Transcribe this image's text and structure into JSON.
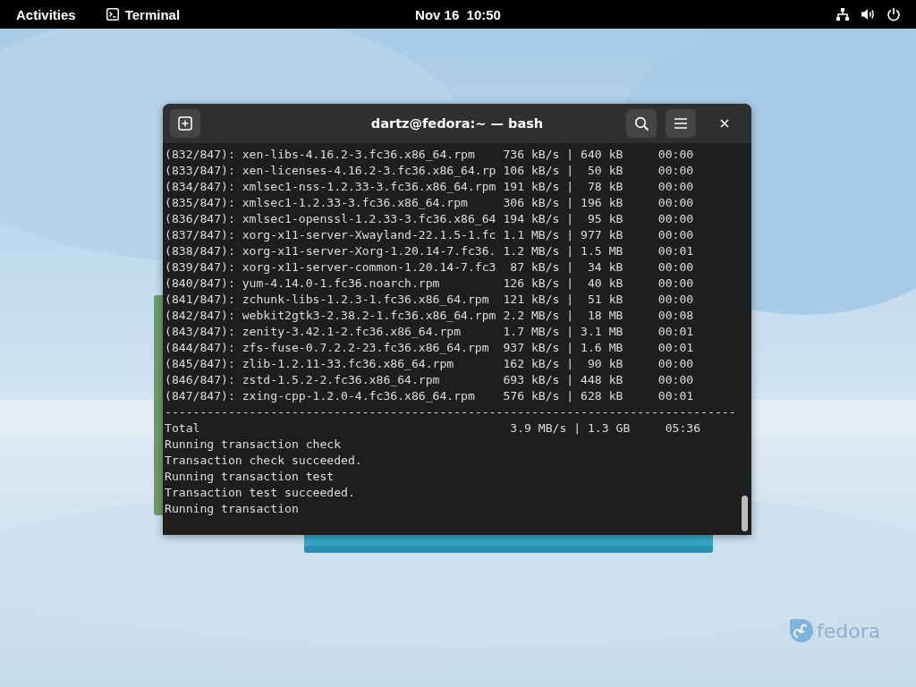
{
  "top_bar": {
    "activities": "Activities",
    "app_menu": "Terminal",
    "clock": "Nov 16  10:50"
  },
  "terminal": {
    "title": "dartz@fedora:~ — bash",
    "lines": [
      "(832/847): xen-libs-4.16.2-3.fc36.x86_64.rpm    736 kB/s | 640 kB     00:00",
      "(833/847): xen-licenses-4.16.2-3.fc36.x86_64.rp 106 kB/s |  50 kB     00:00",
      "(834/847): xmlsec1-nss-1.2.33-3.fc36.x86_64.rpm 191 kB/s |  78 kB     00:00",
      "(835/847): xmlsec1-1.2.33-3.fc36.x86_64.rpm     306 kB/s | 196 kB     00:00",
      "(836/847): xmlsec1-openssl-1.2.33-3.fc36.x86_64 194 kB/s |  95 kB     00:00",
      "(837/847): xorg-x11-server-Xwayland-22.1.5-1.fc 1.1 MB/s | 977 kB     00:00",
      "(838/847): xorg-x11-server-Xorg-1.20.14-7.fc36. 1.2 MB/s | 1.5 MB     00:01",
      "(839/847): xorg-x11-server-common-1.20.14-7.fc3  87 kB/s |  34 kB     00:00",
      "(840/847): yum-4.14.0-1.fc36.noarch.rpm         126 kB/s |  40 kB     00:00",
      "(841/847): zchunk-libs-1.2.3-1.fc36.x86_64.rpm  121 kB/s |  51 kB     00:00",
      "(842/847): webkit2gtk3-2.38.2-1.fc36.x86_64.rpm 2.2 MB/s |  18 MB     00:08",
      "(843/847): zenity-3.42.1-2.fc36.x86_64.rpm      1.7 MB/s | 3.1 MB     00:01",
      "(844/847): zfs-fuse-0.7.2.2-23.fc36.x86_64.rpm  937 kB/s | 1.6 MB     00:01",
      "(845/847): zlib-1.2.11-33.fc36.x86_64.rpm       162 kB/s |  90 kB     00:00",
      "(846/847): zstd-1.5.2-2.fc36.x86_64.rpm         693 kB/s | 448 kB     00:00",
      "(847/847): zxing-cpp-1.2.0-4.fc36.x86_64.rpm    576 kB/s | 628 kB     00:01",
      "---------------------------------------------------------------------------------",
      "Total                                            3.9 MB/s | 1.3 GB     05:36",
      "Running transaction check",
      "Transaction check succeeded.",
      "Running transaction test",
      "Transaction test succeeded.",
      "Running transaction"
    ]
  },
  "desktop_logo": {
    "text": "fedora"
  }
}
